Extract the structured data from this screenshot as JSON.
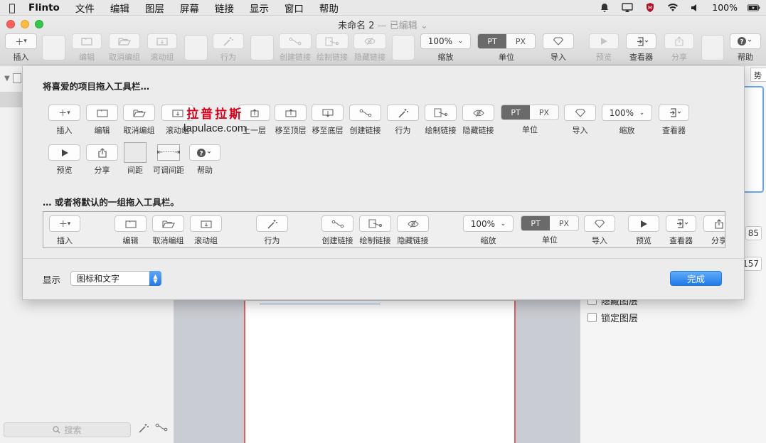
{
  "menubar": {
    "app": "Flinto",
    "items": [
      "文件",
      "编辑",
      "图层",
      "屏幕",
      "链接",
      "显示",
      "窗口",
      "帮助"
    ],
    "battery": "100%"
  },
  "window": {
    "title": "未命名 2",
    "subtitle": "— 已编辑"
  },
  "toolbar": {
    "insert": "插入",
    "edit": "编辑",
    "ungroup": "取消编组",
    "scroll_group": "滚动组",
    "behavior": "行为",
    "create_link": "创建链接",
    "draw_link": "绘制链接",
    "hide_link": "隐藏链接",
    "zoom_value": "100%",
    "zoom": "缩放",
    "unit_pt": "PT",
    "unit_px": "PX",
    "unit": "单位",
    "import": "导入",
    "preview": "预览",
    "viewer": "查看器",
    "share": "分享",
    "help": "帮助"
  },
  "sheet": {
    "heading_custom": "将喜爱的项目拖入工具栏…",
    "heading_default": "… 或者将默认的一组拖入工具栏。",
    "palette": {
      "insert": "插入",
      "edit": "编辑",
      "ungroup": "取消编组",
      "scroll_group": "滚动组",
      "up_layer": "上一层",
      "to_top": "移至顶层",
      "to_bottom": "移至底层",
      "create_link": "创建链接",
      "behavior": "行为",
      "draw_link": "绘制链接",
      "hide_link": "隐藏链接",
      "unit_pt": "PT",
      "unit_px": "PX",
      "unit": "单位",
      "import": "导入",
      "zoom_value": "100%",
      "zoom": "缩放",
      "viewer": "查看器",
      "preview": "预览",
      "share": "分享",
      "space": "间距",
      "flexible_space": "可调间距",
      "help": "帮助"
    },
    "default_set": {
      "insert": "插入",
      "edit": "编辑",
      "ungroup": "取消编组",
      "scroll_group": "滚动组",
      "behavior": "行为",
      "create_link": "创建链接",
      "draw_link": "绘制链接",
      "hide_link": "隐藏链接",
      "zoom_value": "100%",
      "zoom": "缩放",
      "unit_pt": "PT",
      "unit_px": "PX",
      "unit": "单位",
      "import": "导入",
      "preview": "预览",
      "viewer": "查看器",
      "share": "分享"
    },
    "show_label": "显示",
    "show_value": "图标和文字",
    "done": "完成",
    "watermark_cn": "拉普拉斯",
    "watermark_url": "lapulace.com"
  },
  "left": {
    "search_placeholder": "搜索"
  },
  "right": {
    "hide_layer": "隐藏图层",
    "lock_layer": "锁定图层",
    "num1": "85",
    "num2": "157",
    "dropdown_frag": "势"
  },
  "colors": {
    "accent": "#2477e9",
    "artboard_border": "#e06060",
    "canvas": "#c9ccd2"
  }
}
